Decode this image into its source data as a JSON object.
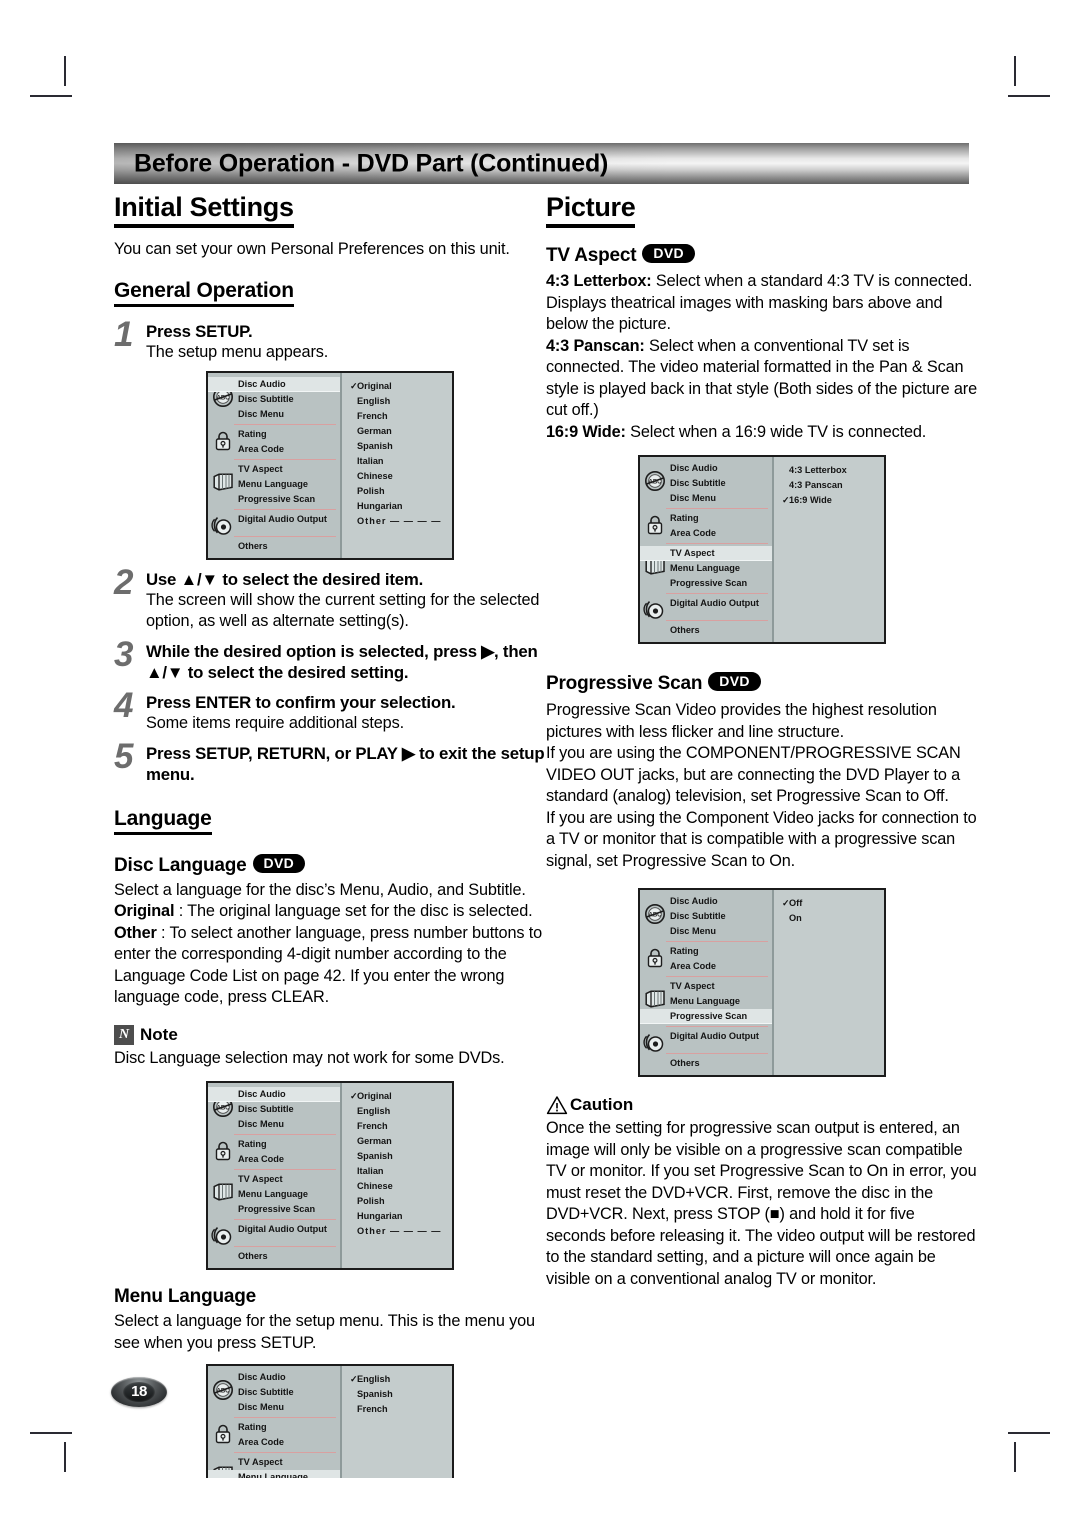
{
  "page": {
    "number": "18",
    "banner_title": "Before Operation - DVD Part (Continued)"
  },
  "left_column": {
    "section_title": "Initial Settings",
    "intro": "You can set your own Personal Preferences on this unit.",
    "general_operation": {
      "heading": "General Operation",
      "steps": [
        {
          "num": "1",
          "title": "Press SETUP.",
          "desc": "The setup menu appears."
        },
        {
          "num": "2",
          "title": "Use ▲/▼ to select the desired item.",
          "desc": "The screen will show the current setting for the selected option, as well as alternate setting(s)."
        },
        {
          "num": "3",
          "title": "While the desired option is selected, press ▶, then ▲/▼ to select the desired setting.",
          "desc": ""
        },
        {
          "num": "4",
          "title": "Press ENTER to confirm your selection.",
          "desc": "Some items require additional steps."
        },
        {
          "num": "5",
          "title": "Press SETUP, RETURN, or PLAY ▶ to exit the setup menu.",
          "desc": ""
        }
      ]
    },
    "language": {
      "heading": "Language",
      "disc_language": {
        "title": "Disc Language",
        "badge": "DVD",
        "line1": "Select a language for the disc’s Menu, Audio, and Subtitle.",
        "original_label": "Original",
        "original_text": " : The original language set for the disc is selected.",
        "other_label": "Other",
        "other_text": " : To select another language, press number buttons to enter the corresponding 4-digit number according to the Language Code List on page 42. If you enter the wrong language code, press CLEAR."
      },
      "note": {
        "icon": "N",
        "label": "Note",
        "text": "Disc Language selection may not work for some DVDs."
      },
      "menu_language": {
        "title": "Menu Language",
        "text": "Select a language for the setup menu. This is the menu you see when you press SETUP."
      }
    }
  },
  "right_column": {
    "section_title": "Picture",
    "tv_aspect": {
      "title": "TV Aspect",
      "badge": "DVD",
      "paragraphs": [
        {
          "label": "4:3 Letterbox:",
          "text": " Select when a standard 4:3 TV is connected. Displays theatrical images with masking bars above and below the picture."
        },
        {
          "label": "4:3 Panscan:",
          "text": " Select when a conventional TV set is connected. The video material formatted in the Pan & Scan style is played back in that style (Both sides of the picture are cut off.)"
        },
        {
          "label": "16:9 Wide:",
          "text": " Select when a 16:9 wide TV is connected."
        }
      ]
    },
    "progressive_scan": {
      "title": "Progressive Scan",
      "badge": "DVD",
      "text": "Progressive Scan Video provides the highest resolution pictures with less flicker and line structure.\nIf you are using the COMPONENT/PROGRESSIVE SCAN VIDEO OUT jacks, but are connecting the DVD Player to a standard (analog) television, set Progressive Scan to Off.\nIf you are using the Component Video jacks for connection to a TV or monitor that is compatible with a progressive scan signal, set Progressive Scan to On."
    },
    "caution": {
      "label": "Caution",
      "text": "Once the setting for progressive scan output is entered, an image will only be visible on a progressive scan compatible TV or monitor. If you set Progressive Scan to On in error, you must reset the DVD+VCR. First, remove the disc in the DVD+VCR. Next, press STOP (■) and hold it for five seconds before releasing it. The video output will be restored to the standard setting, and a picture will once again be visible on a conventional analog TV or monitor."
    }
  },
  "osd_menus": {
    "sidebar_items": [
      "Disc Audio",
      "Disc Subtitle",
      "Disc Menu",
      "Rating",
      "Area Code",
      "TV Aspect",
      "Menu Language",
      "Progressive Scan",
      "Digital Audio Output",
      "Others"
    ],
    "disc_audio_menu": {
      "selected_row": "Disc Audio",
      "options": [
        "Original",
        "English",
        "French",
        "German",
        "Spanish",
        "Italian",
        "Chinese",
        "Polish",
        "Hungarian",
        "Other — — — —"
      ],
      "checked": "Original"
    },
    "menu_language_menu": {
      "selected_row": "Menu Language",
      "options": [
        "English",
        "Spanish",
        "French"
      ],
      "checked": "English"
    },
    "tv_aspect_menu": {
      "selected_row": "TV Aspect",
      "options": [
        "4:3 Letterbox",
        "4:3 Panscan",
        "16:9 Wide"
      ],
      "checked": "16:9 Wide"
    },
    "progressive_scan_menu": {
      "selected_row": "Progressive Scan",
      "options": [
        "Off",
        "On"
      ],
      "checked": "Off"
    }
  }
}
